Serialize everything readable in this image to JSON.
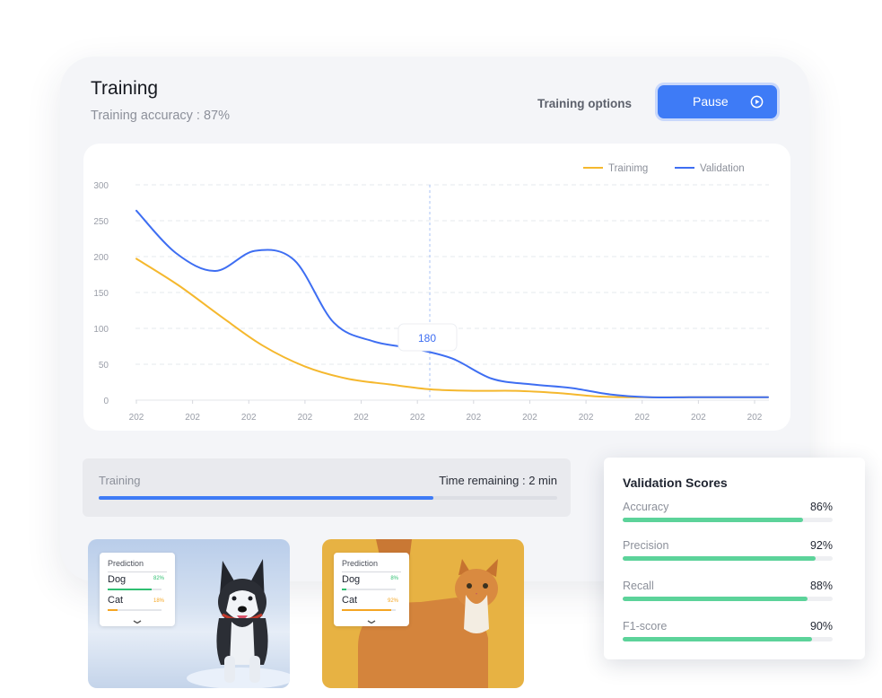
{
  "header": {
    "title": "Training",
    "subtitle": "Training accuracy : 87%",
    "options_label": "Training options",
    "pause_label": "Pause"
  },
  "chart_data": {
    "type": "line",
    "categories": [
      "202",
      "202",
      "202",
      "202",
      "202",
      "202",
      "202",
      "202",
      "202",
      "202",
      "202",
      "202"
    ],
    "yticks": [
      300,
      250,
      200,
      150,
      100,
      50,
      0
    ],
    "ylim": [
      0,
      300
    ],
    "grid": true,
    "legend_position": "top-right",
    "tooltip": "180",
    "series": [
      {
        "name": "Trainimg",
        "color": "#f5b82e",
        "values": [
          197,
          160,
          117,
          76,
          47,
          30,
          22,
          15,
          13,
          13,
          10,
          5,
          4,
          4,
          4,
          4
        ]
      },
      {
        "name": "Validation",
        "color": "#3e6ef2",
        "values": [
          264,
          205,
          180,
          208,
          195,
          108,
          82,
          72,
          58,
          30,
          22,
          17,
          8,
          4,
          4,
          4,
          4
        ]
      }
    ]
  },
  "progress": {
    "label": "Training",
    "time_remaining": "Time remaining : 2 min",
    "value": 0.73
  },
  "predictions": [
    {
      "title": "Prediction",
      "rows": [
        {
          "label": "Dog",
          "pct": "82%",
          "value": 0.82,
          "color": "#2fbf71"
        },
        {
          "label": "Cat",
          "pct": "18%",
          "value": 0.18,
          "color": "#f5a623"
        }
      ]
    },
    {
      "title": "Prediction",
      "rows": [
        {
          "label": "Dog",
          "pct": "8%",
          "value": 0.08,
          "color": "#2fbf71"
        },
        {
          "label": "Cat",
          "pct": "92%",
          "value": 0.92,
          "color": "#f5a623"
        }
      ]
    }
  ],
  "validation": {
    "title": "Validation Scores",
    "rows": [
      {
        "name": "Accuracy",
        "pct": "86%",
        "value": 0.86
      },
      {
        "name": "Precision",
        "pct": "92%",
        "value": 0.92
      },
      {
        "name": "Recall",
        "pct": "88%",
        "value": 0.88
      },
      {
        "name": "F1-score",
        "pct": "90%",
        "value": 0.9
      }
    ]
  },
  "colors": {
    "accent": "#3e7bf6",
    "score_green": "#5cd39a"
  }
}
